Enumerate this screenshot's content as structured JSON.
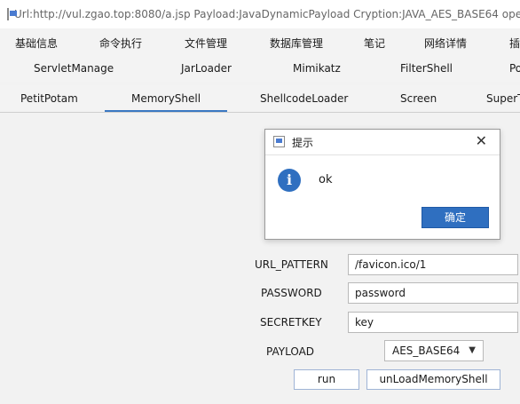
{
  "window": {
    "title": "Url:http://vul.zgao.top:8080/a.jsp Payload:JavaDynamicPayload Cryption:JAVA_AES_BASE64 ope"
  },
  "menu": [
    "基础信息",
    "命令执行",
    "文件管理",
    "数据库管理",
    "笔记",
    "网络详情",
    "插"
  ],
  "tabs_row2": [
    "ServletManage",
    "JarLoader",
    "Mimikatz",
    "FilterShell",
    "Po"
  ],
  "tabs_row3": [
    "PetitPotam",
    "MemoryShell",
    "ShellcodeLoader",
    "Screen",
    "SuperT"
  ],
  "active_tab": "MemoryShell",
  "dialog": {
    "title": "提示",
    "close": "✕",
    "info_icon": "i",
    "message": "ok",
    "ok_label": "确定"
  },
  "form": {
    "url_pattern_label": "URL_PATTERN",
    "url_pattern_value": "/favicon.ico/1",
    "password_label": "PASSWORD",
    "password_value": "password",
    "secretkey_label": "SECRETKEY",
    "secretkey_value": "key",
    "payload_label": "PAYLOAD",
    "payload_value": "AES_BASE64"
  },
  "buttons": {
    "run": "run",
    "unload": "unLoadMemoryShell"
  },
  "colors": {
    "accent": "#2f6fc0",
    "active_tab_underline": "#3a78c2"
  }
}
